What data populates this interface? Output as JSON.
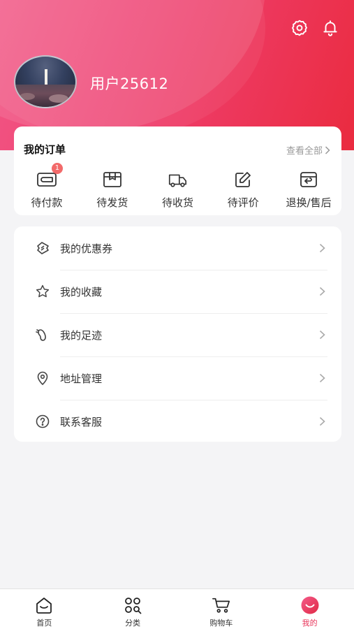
{
  "header": {
    "username": "用户25612",
    "icons": [
      "gear-icon",
      "bell-icon"
    ]
  },
  "orders": {
    "title": "我的订单",
    "view_all": "查看全部",
    "items": [
      {
        "label": "待付款",
        "icon": "wallet-icon",
        "badge": "1"
      },
      {
        "label": "待发货",
        "icon": "box-icon"
      },
      {
        "label": "待收货",
        "icon": "truck-icon"
      },
      {
        "label": "待评价",
        "icon": "edit-icon"
      },
      {
        "label": "退换/售后",
        "icon": "return-icon"
      }
    ]
  },
  "menu": {
    "items": [
      {
        "label": "我的优惠券",
        "icon": "coupon-icon"
      },
      {
        "label": "我的收藏",
        "icon": "star-icon"
      },
      {
        "label": "我的足迹",
        "icon": "footprint-icon"
      },
      {
        "label": "地址管理",
        "icon": "location-icon"
      },
      {
        "label": "联系客服",
        "icon": "help-icon"
      }
    ]
  },
  "nav": {
    "items": [
      {
        "label": "首页",
        "icon": "home-icon"
      },
      {
        "label": "分类",
        "icon": "category-icon"
      },
      {
        "label": "购物车",
        "icon": "cart-icon"
      },
      {
        "label": "我的",
        "icon": "profile-icon",
        "active": true
      }
    ]
  },
  "colors": {
    "accent": "#e8345a",
    "header_start": "#f25786",
    "header_end": "#ea2b3f",
    "badge": "#f26a6a"
  }
}
